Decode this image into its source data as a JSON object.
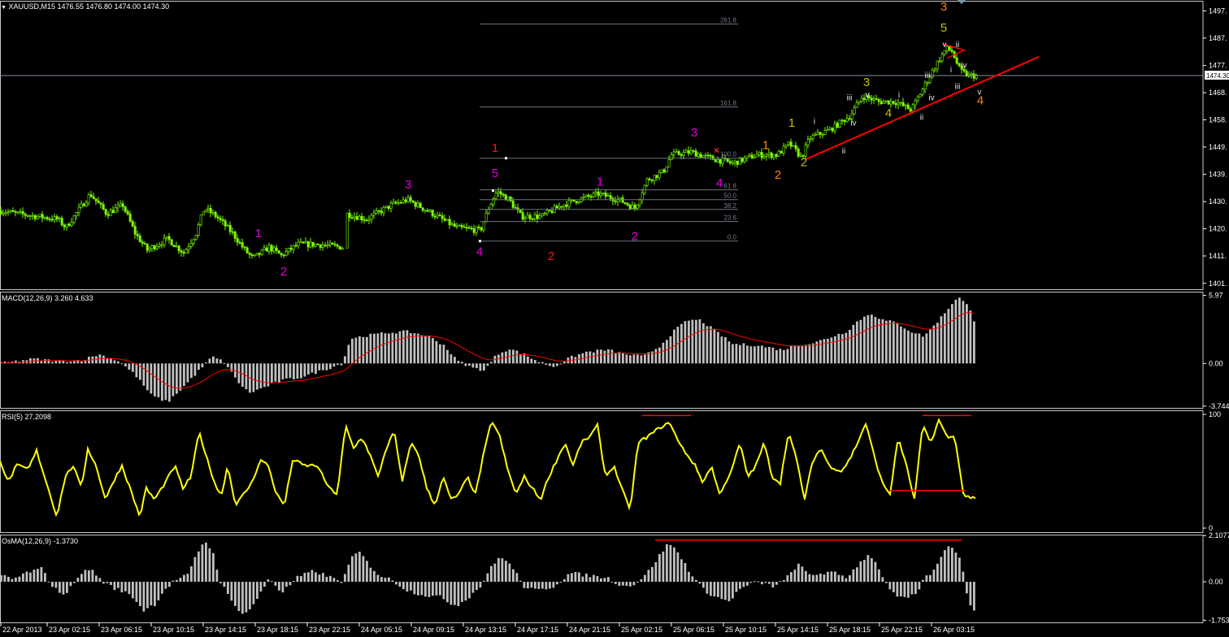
{
  "header": {
    "symbol_line": "XAUUSD,M15  1476.55 1476.80 1474.00 1474.30",
    "price_tag": "1474.30"
  },
  "chart_data": [
    {
      "type": "line",
      "name": "main-price",
      "ylim": [
        1398,
        1501
      ],
      "yticks": [
        1497.4,
        1487.7,
        1477.9,
        1468.2,
        1458.5,
        1448.8,
        1439.0,
        1429.3,
        1419.6,
        1409.9,
        1400.1
      ],
      "ytick_labels": [
        "1497.",
        "1487.",
        "1477.",
        "1468.",
        "1458.",
        "1449.",
        "1439.",
        "1430.",
        "1420.",
        "1411.",
        "1401."
      ],
      "current_price": 1474.3,
      "fib_levels": [
        {
          "label": "261.8",
          "value": 1492.7
        },
        {
          "label": "161.8",
          "value": 1463.1
        },
        {
          "label": "100.0",
          "value": 1444.8
        },
        {
          "label": "61.8",
          "value": 1433.5
        },
        {
          "label": "50.0",
          "value": 1430.0
        },
        {
          "label": "38.2",
          "value": 1426.5
        },
        {
          "label": "23.6",
          "value": 1422.2
        },
        {
          "label": "0.0",
          "value": 1415.2
        }
      ],
      "wave_labels": [
        {
          "t": "1",
          "color": "#e000e0",
          "x": 318,
          "y": 1416.5
        },
        {
          "t": "2",
          "color": "#e000e0",
          "x": 349,
          "y": 1403.0
        },
        {
          "t": "3",
          "color": "#e000e0",
          "x": 502,
          "y": 1434.0
        },
        {
          "t": "4",
          "color": "#e000e0",
          "x": 590,
          "y": 1410.0
        },
        {
          "t": "5",
          "color": "#e000e0",
          "x": 609,
          "y": 1438.0
        },
        {
          "t": "1",
          "color": "#ff1010",
          "x": 609,
          "y": 1447.0
        },
        {
          "t": "2",
          "color": "#ff1010",
          "x": 678,
          "y": 1408.5
        },
        {
          "t": "1",
          "color": "#e000e0",
          "x": 738,
          "y": 1435.0
        },
        {
          "t": "2",
          "color": "#e000e0",
          "x": 781,
          "y": 1415.5
        },
        {
          "t": "3",
          "color": "#e000e0",
          "x": 854,
          "y": 1452.5
        },
        {
          "t": "4",
          "color": "#e000e0",
          "x": 885,
          "y": 1434.5
        },
        {
          "t": "1",
          "color": "#ff8000",
          "x": 942,
          "y": 1448.0
        },
        {
          "t": "2",
          "color": "#ff8000",
          "x": 957,
          "y": 1437.5
        },
        {
          "t": "1",
          "color": "#c0c000",
          "x": 974,
          "y": 1456.0
        },
        {
          "t": "2",
          "color": "#c0c000",
          "x": 989,
          "y": 1442.0
        },
        {
          "t": "3",
          "color": "#c0c000",
          "x": 1066,
          "y": 1470.5
        },
        {
          "t": "4",
          "color": "#c0c000",
          "x": 1093,
          "y": 1459.5
        },
        {
          "t": "3",
          "color": "#ff8000",
          "x": 1161,
          "y": 1497.5
        },
        {
          "t": "5",
          "color": "#c0c000",
          "x": 1161,
          "y": 1490.0
        },
        {
          "t": "4",
          "color": "#ff8000",
          "x": 1206,
          "y": 1464.0
        }
      ],
      "sub_labels": [
        {
          "t": "i",
          "x": 1002,
          "y": 1457.0
        },
        {
          "t": "ii",
          "x": 1038,
          "y": 1446.5
        },
        {
          "t": "iii",
          "x": 1045,
          "y": 1465.5
        },
        {
          "t": "iv",
          "x": 1050,
          "y": 1456.5
        },
        {
          "t": "v",
          "x": 1067,
          "y": 1466.5
        },
        {
          "t": "i",
          "x": 1106,
          "y": 1466.5
        },
        {
          "t": "ii",
          "x": 1134,
          "y": 1458.5
        },
        {
          "t": "iii",
          "x": 1141,
          "y": 1473.5
        },
        {
          "t": "iv",
          "x": 1146,
          "y": 1465.5
        },
        {
          "t": "v",
          "x": 1162,
          "y": 1484.5
        },
        {
          "t": "ii",
          "x": 1178,
          "y": 1484.5
        },
        {
          "t": "i",
          "x": 1170,
          "y": 1475.5
        },
        {
          "t": "iv",
          "x": 1186,
          "y": 1477.0
        },
        {
          "t": "iii",
          "x": 1178,
          "y": 1469.5
        },
        {
          "t": "v",
          "x": 1205,
          "y": 1467.5
        }
      ]
    },
    {
      "type": "bar",
      "name": "macd",
      "title": "MACD(12,26,9) 3.260 4.633",
      "ylim": [
        -3.9,
        6.3
      ],
      "ytick_labels": [
        "5.97",
        "0.00",
        "-3.744"
      ],
      "yticks": [
        5.97,
        0.0,
        -3.744
      ]
    },
    {
      "type": "line",
      "name": "rsi",
      "title": "RSI(5) 27.2098",
      "ylim": [
        0,
        100
      ],
      "ytick_labels": [
        "100",
        "0"
      ],
      "yticks": [
        100,
        0
      ]
    },
    {
      "type": "bar",
      "name": "osma",
      "title": "OsMA(12,26,9) -1.3730",
      "ylim": [
        -1.85,
        2.15
      ],
      "ytick_labels": [
        "2.1077",
        "0.00",
        "-1.753"
      ],
      "yticks": [
        2.1077,
        0.0,
        -1.753
      ]
    }
  ],
  "x_axis": [
    "22 Apr 2013",
    "23 Apr 02:15",
    "23 Apr 06:15",
    "23 Apr 10:15",
    "23 Apr 14:15",
    "23 Apr 18:15",
    "23 Apr 22:15",
    "24 Apr 05:15",
    "24 Apr 09:15",
    "24 Apr 13:15",
    "24 Apr 17:15",
    "24 Apr 21:15",
    "25 Apr 02:15",
    "25 Apr 06:15",
    "25 Apr 10:15",
    "25 Apr 14:15",
    "25 Apr 18:15",
    "25 Apr 22:15",
    "26 Apr 03:15"
  ],
  "colors": {
    "bull_candle": "#7cfc00",
    "macd_line": "#ff0000",
    "rsi_line": "#ffff00",
    "trend_line": "#ff0000",
    "histogram": "#c0c0c0",
    "grid": "#808080"
  }
}
